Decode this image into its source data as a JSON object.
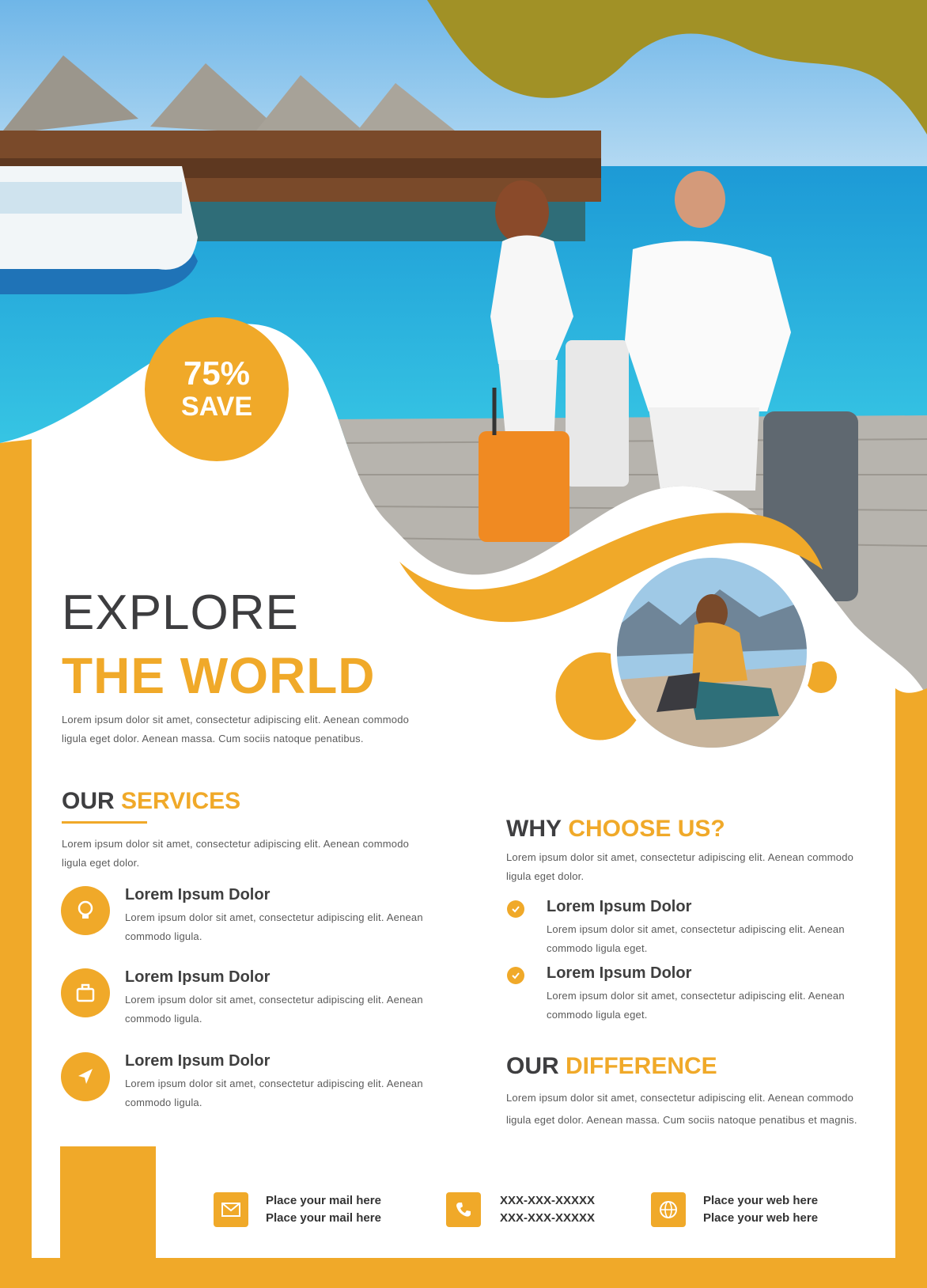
{
  "badge": {
    "percent": "75%",
    "label": "SAVE"
  },
  "hero": {
    "line1": "EXPLORE",
    "line2": "THE WORLD",
    "description": "Lorem ipsum dolor sit amet, consectetur adipiscing elit. Aenean commodo ligula eget dolor. Aenean massa. Cum sociis natoque penatibus."
  },
  "services": {
    "heading_dark": "OUR",
    "heading_orange": "SERVICES",
    "description": "Lorem ipsum dolor sit amet, consectetur adipiscing elit. Aenean commodo ligula eget dolor.",
    "items": [
      {
        "title": "Lorem Ipsum Dolor",
        "text": "Lorem ipsum dolor sit amet, consectetur adipiscing elit. Aenean commodo ligula."
      },
      {
        "title": "Lorem Ipsum Dolor",
        "text": "Lorem ipsum dolor sit amet, consectetur adipiscing elit. Aenean commodo ligula."
      },
      {
        "title": "Lorem Ipsum Dolor",
        "text": "Lorem ipsum dolor sit amet, consectetur adipiscing elit. Aenean commodo ligula."
      }
    ]
  },
  "why_choose": {
    "heading_dark": "WHY",
    "heading_orange": "CHOOSE US?",
    "description": "Lorem ipsum dolor sit amet, consectetur adipiscing elit. Aenean commodo ligula eget dolor.",
    "items": [
      {
        "title": "Lorem Ipsum Dolor",
        "text": "Lorem ipsum dolor sit amet, consectetur adipiscing elit. Aenean commodo ligula eget."
      },
      {
        "title": "Lorem Ipsum Dolor",
        "text": "Lorem ipsum dolor sit amet, consectetur adipiscing elit. Aenean commodo ligula eget."
      }
    ]
  },
  "difference": {
    "heading_dark": "OUR",
    "heading_orange": "DIFFERENCE",
    "description": "Lorem ipsum dolor sit amet, consectetur adipiscing elit. Aenean commodo ligula eget dolor. Aenean massa. Cum sociis natoque penatibus et magnis."
  },
  "footer": {
    "email": [
      "Place your mail here",
      "Place your mail here"
    ],
    "phone": [
      "XXX-XXX-XXXXX",
      "XXX-XXX-XXXXX"
    ],
    "web": [
      "Place your web here",
      "Place your web here"
    ]
  },
  "colors": {
    "accent": "#f0a929",
    "olive": "#a19126",
    "heading_dark": "#3e3e40",
    "sea": "#1d9ad6"
  }
}
